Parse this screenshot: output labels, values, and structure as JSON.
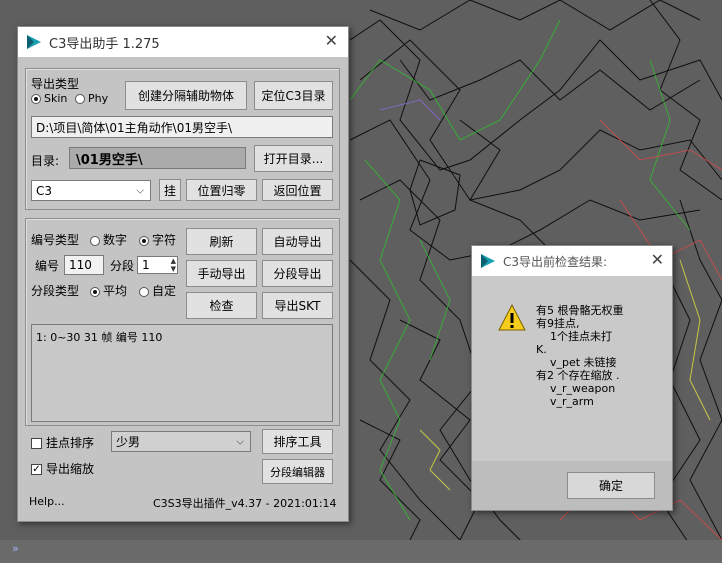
{
  "main_window": {
    "title": "C3导出助手 1.275",
    "export_type": {
      "label": "导出类型",
      "options": [
        "Skin",
        "Phy"
      ],
      "selected": "Skin"
    },
    "create_helper_button": "创建分隔辅助物体",
    "locate_c3_button": "定位C3目录",
    "path_value": "D:\\项目\\简体\\01主角动作\\01男空手\\",
    "dir_label": "目录:",
    "dir_value": "\\01男空手\\",
    "open_dir_button": "打开目录...",
    "format_select": "C3",
    "hang_button": "挂",
    "reset_pos_button": "位置归零",
    "return_pos_button": "返回位置",
    "numbering_type": {
      "label": "编号类型",
      "options": [
        "数字",
        "字符"
      ],
      "selected": "字符"
    },
    "refresh_button": "刷新",
    "auto_export_button": "自动导出",
    "number_label": "编号",
    "number_value": "110",
    "segment_label": "分段",
    "segment_value": "1",
    "manual_export_button": "手动导出",
    "segment_export_button": "分段导出",
    "segment_type": {
      "label": "分段类型",
      "options": [
        "平均",
        "自定"
      ],
      "selected": "平均"
    },
    "check_button": "检查",
    "export_skt_button": "导出SKT",
    "segments_list": [
      "1: 0~30 31 帧 编号 110"
    ],
    "sort_hang_points": {
      "label": "挂点排序",
      "checked": false
    },
    "character_select": "少男",
    "sort_tool_button": "排序工具",
    "export_scale": {
      "label": "导出缩放",
      "checked": true
    },
    "segment_editor_button": "分段编辑器",
    "help_text": "Help...",
    "version_text": "C3S3导出插件_v4.37 - 2021:01:14"
  },
  "dialog": {
    "title": "C3导出前检查结果:",
    "icon": "warning-icon",
    "message_lines": [
      "有5 根骨骼无权重",
      "有9挂点,",
      "    1个挂点未打",
      "K.",
      "    v_pet 未链接",
      "有2 个存在缩放 .",
      "    v_r_weapon",
      "    v_r_arm"
    ],
    "ok_button": "确定"
  },
  "viewport_corner": "»"
}
